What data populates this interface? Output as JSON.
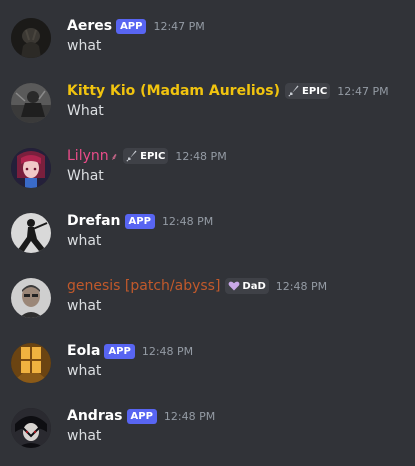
{
  "messages": [
    {
      "username": "Aeres",
      "username_color": "#ffffff",
      "tag": "APP",
      "timestamp": "12:47 PM",
      "content": "what",
      "avatar_icon": "dark-figure-avatar"
    },
    {
      "username": "Kitty Kio (Madam Aurelios)",
      "username_color": "#f1c40f",
      "guild_tag": "EPIC",
      "guild_tag_icon": "sword-icon",
      "timestamp": "12:47 PM",
      "content": "What",
      "avatar_icon": "gray-figure-avatar"
    },
    {
      "username": "Lilynn",
      "username_color": "#ea4c89",
      "username_suffix": "⸙",
      "guild_tag": "EPIC",
      "guild_tag_icon": "sword-icon",
      "timestamp": "12:48 PM",
      "content": "What",
      "avatar_icon": "anime-character-avatar"
    },
    {
      "username": "Drefan",
      "username_color": "#ffffff",
      "tag": "APP",
      "timestamp": "12:48 PM",
      "content": "what",
      "avatar_icon": "silhouette-avatar"
    },
    {
      "username": "genesis [patch/abyss]",
      "username_color": "#c1592b",
      "guild_tag": "DaD",
      "guild_tag_icon": "heart-icon",
      "timestamp": "12:48 PM",
      "content": "what",
      "avatar_icon": "person-avatar"
    },
    {
      "username": "Eola",
      "username_color": "#ffffff",
      "tag": "APP",
      "timestamp": "12:48 PM",
      "content": "what",
      "avatar_icon": "window-light-avatar"
    },
    {
      "username": "Andras",
      "username_color": "#ffffff",
      "tag": "APP",
      "timestamp": "12:48 PM",
      "content": "what",
      "avatar_icon": "dark-anime-avatar"
    }
  ],
  "colors": {
    "background": "#313338",
    "app_tag": "#5865f2",
    "timestamp": "#949ba4",
    "text": "#dbdee1"
  }
}
